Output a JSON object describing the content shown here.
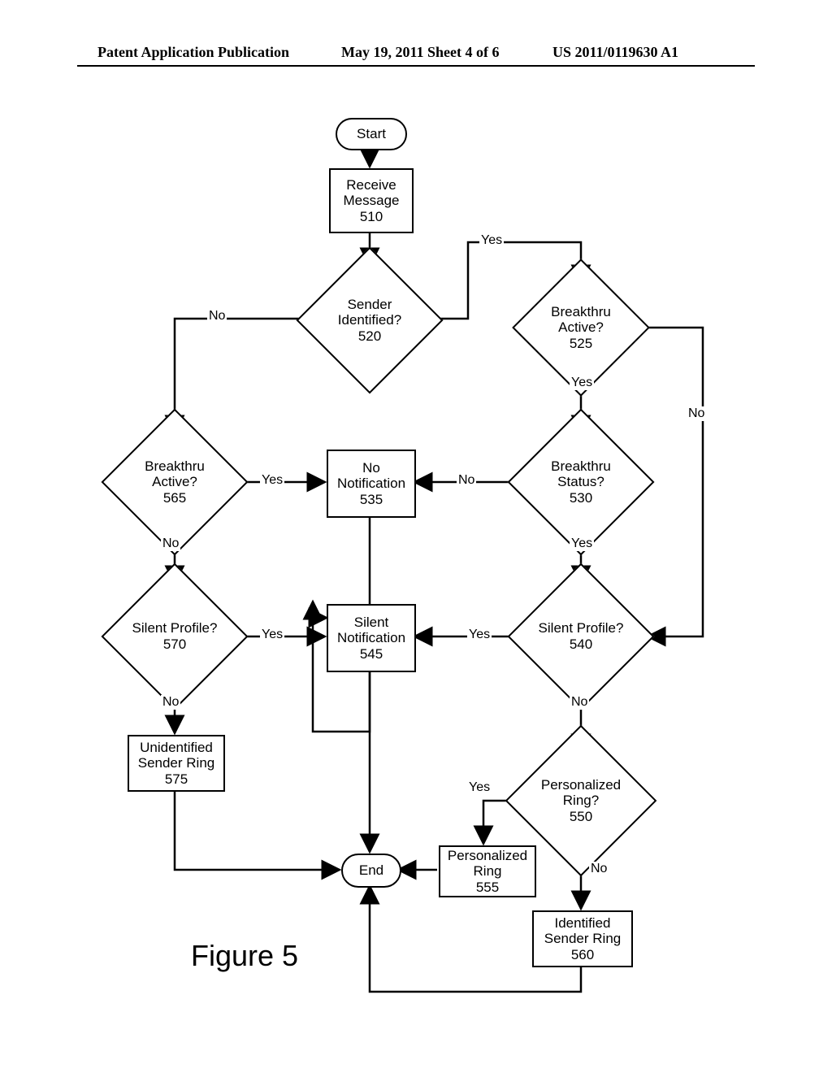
{
  "header": {
    "left": "Patent Application Publication",
    "middle": "May 19, 2011  Sheet 4 of 6",
    "right": "US 2011/0119630 A1"
  },
  "figure_label": "Figure 5",
  "nodes": {
    "start": {
      "line1": "Start"
    },
    "n510": {
      "line1": "Receive",
      "line2": "Message",
      "num": "510"
    },
    "n520": {
      "line1": "Sender",
      "line2": "Identified?",
      "num": "520"
    },
    "n525": {
      "line1": "Breakthru",
      "line2": "Active?",
      "num": "525"
    },
    "n530": {
      "line1": "Breakthru",
      "line2": "Status?",
      "num": "530"
    },
    "n535": {
      "line1": "No",
      "line2": "Notification",
      "num": "535"
    },
    "n540": {
      "line1": "Silent Profile?",
      "num": "540"
    },
    "n545": {
      "line1": "Silent",
      "line2": "Notification",
      "num": "545"
    },
    "n550": {
      "line1": "Personalized",
      "line2": "Ring?",
      "num": "550"
    },
    "n555": {
      "line1": "Personalized",
      "line2": "Ring",
      "num": "555"
    },
    "n560": {
      "line1": "Identified",
      "line2": "Sender Ring",
      "num": "560"
    },
    "n565": {
      "line1": "Breakthru",
      "line2": "Active?",
      "num": "565"
    },
    "n570": {
      "line1": "Silent Profile?",
      "num": "570"
    },
    "n575": {
      "line1": "Unidentified",
      "line2": "Sender Ring",
      "num": "575"
    },
    "end": {
      "line1": "End"
    }
  },
  "labels": {
    "yes": "Yes",
    "no": "No"
  }
}
